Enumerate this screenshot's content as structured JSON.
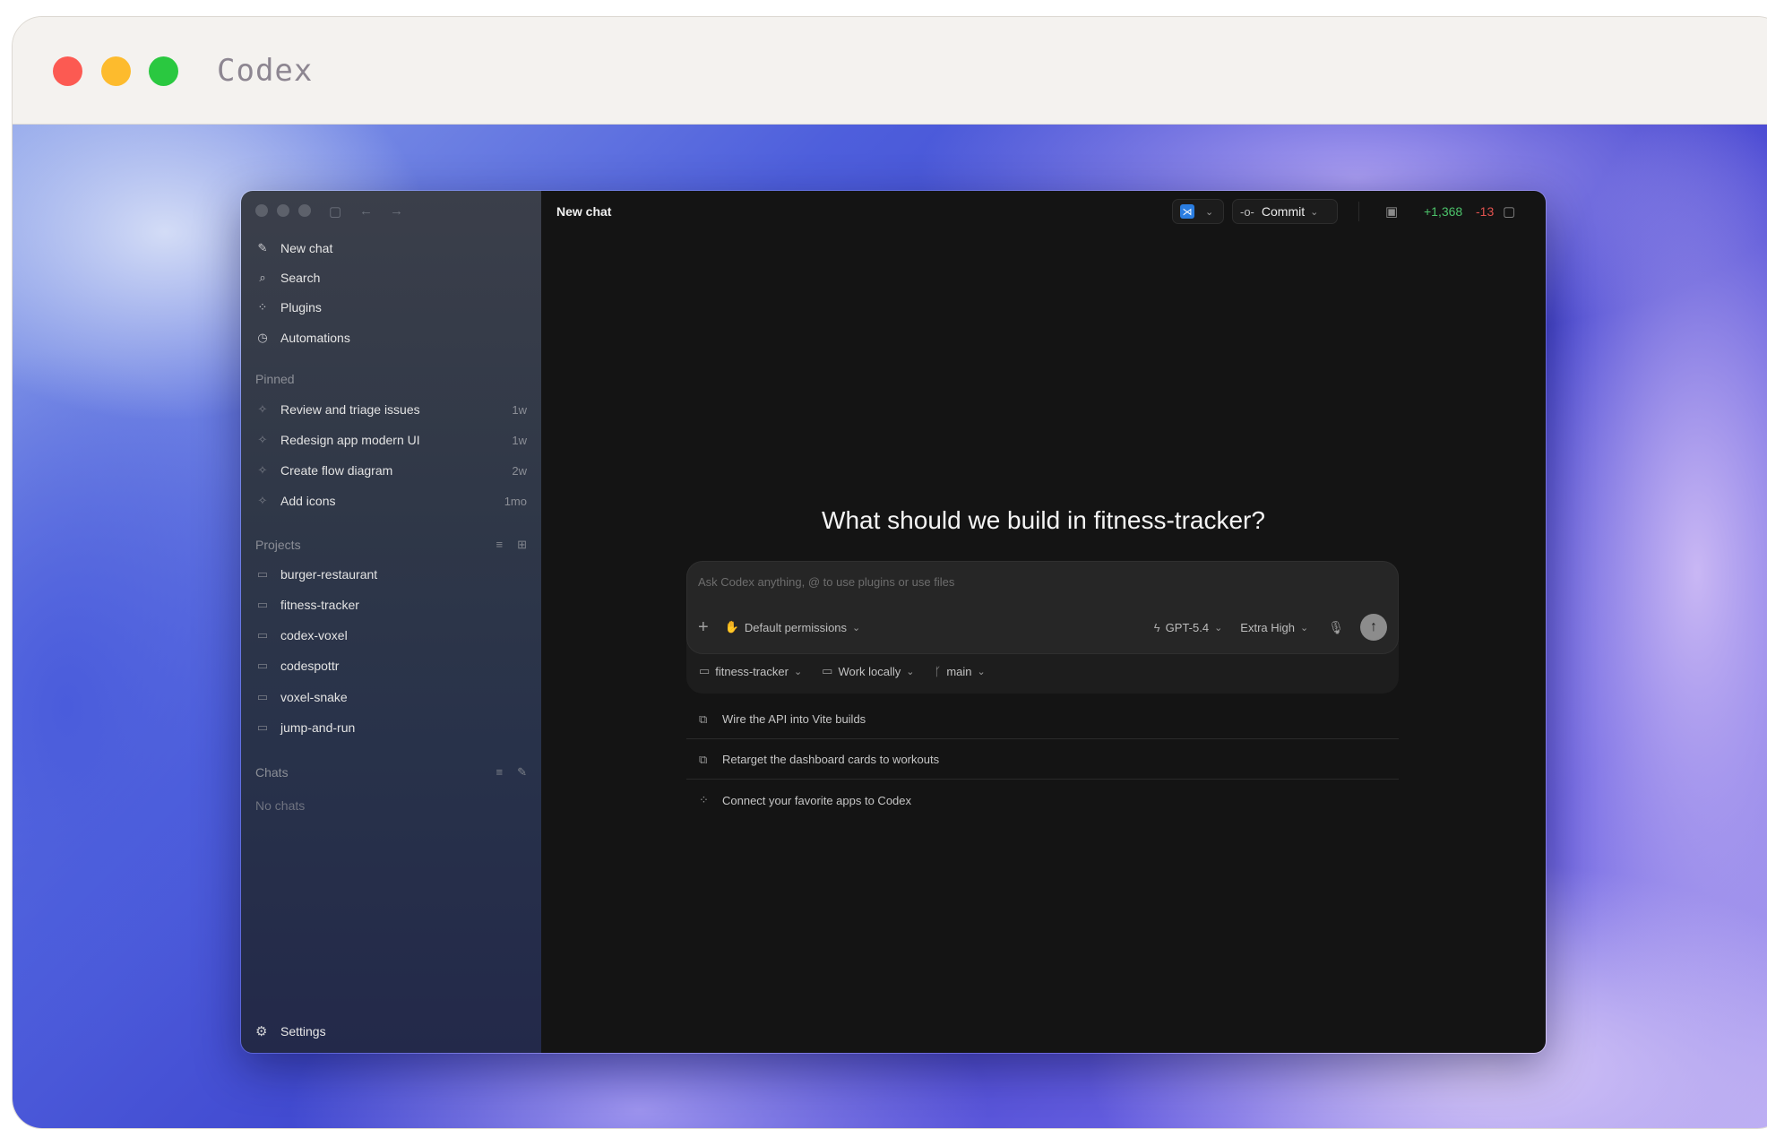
{
  "outer_window": {
    "title": "Codex"
  },
  "sidebar": {
    "nav": [
      {
        "label": "New chat",
        "icon": "edit-icon"
      },
      {
        "label": "Search",
        "icon": "search-icon"
      },
      {
        "label": "Plugins",
        "icon": "grid-icon"
      },
      {
        "label": "Automations",
        "icon": "clock-icon"
      }
    ],
    "pinned_title": "Pinned",
    "pinned": [
      {
        "label": "Review and triage issues",
        "age": "1w"
      },
      {
        "label": "Redesign app modern UI",
        "age": "1w"
      },
      {
        "label": "Create flow diagram",
        "age": "2w"
      },
      {
        "label": "Add icons",
        "age": "1mo"
      }
    ],
    "projects_title": "Projects",
    "projects": [
      {
        "label": "burger-restaurant"
      },
      {
        "label": "fitness-tracker"
      },
      {
        "label": "codex-voxel"
      },
      {
        "label": "codespottr"
      },
      {
        "label": "voxel-snake"
      },
      {
        "label": "jump-and-run"
      }
    ],
    "chats_title": "Chats",
    "chats_empty": "No chats",
    "settings_label": "Settings"
  },
  "header": {
    "title": "New chat",
    "commit_label": "Commit",
    "diff_added": "+1,368",
    "diff_removed": "-13",
    "added_color": "#4cc26a",
    "removed_color": "#e0524e"
  },
  "main": {
    "hero": "What should we build in fitness-tracker?",
    "composer": {
      "placeholder": "Ask Codex anything, @ to use plugins or use files",
      "permissions": "Default permissions",
      "model": "GPT-5.4",
      "reasoning": "Extra High"
    },
    "context": {
      "project": "fitness-tracker",
      "location": "Work locally",
      "branch": "main"
    },
    "suggestions": [
      {
        "label": "Wire the API into Vite builds",
        "icon": "link-icon"
      },
      {
        "label": "Retarget the dashboard cards to workouts",
        "icon": "link-icon"
      },
      {
        "label": "Connect your favorite apps to Codex",
        "icon": "grid-icon"
      }
    ]
  }
}
